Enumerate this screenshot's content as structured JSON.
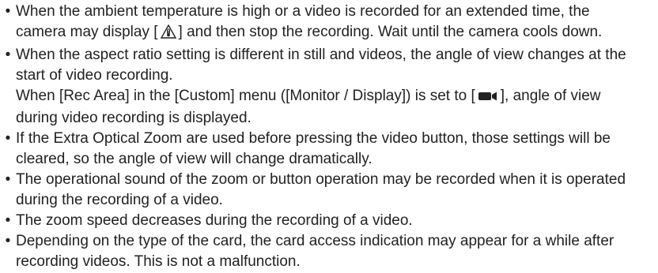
{
  "notes": [
    {
      "id": "temperature",
      "line1": "When the ambient temperature is high or a video is recorded for an extended time, the",
      "line2_before": "camera may display [",
      "line2_icon": "temperature-warning-icon",
      "line2_after": "] and then stop the recording. Wait until the camera cools down."
    },
    {
      "id": "aspect-ratio",
      "line1": "When the aspect ratio setting is different in still and videos, the angle of view changes at the",
      "line2": "start of video recording.",
      "line3_before": "When [Rec Area] in the [Custom] menu ([Monitor / Display]) is set to [",
      "line3_icon": "movie-camera-icon",
      "line3_after": "], angle of view",
      "line4": "during video recording is displayed."
    },
    {
      "id": "extra-zoom",
      "line1": "If the Extra Optical Zoom are used before pressing the video button, those settings will be",
      "line2": "cleared, so the angle of view will change dramatically."
    },
    {
      "id": "operational-sound",
      "line1": "The operational sound of the zoom or button operation may be recorded when it is operated",
      "line2": "during the recording of a video."
    },
    {
      "id": "zoom-speed",
      "line1": "The zoom speed decreases during the recording of a video."
    },
    {
      "id": "card-access",
      "line1": "Depending on the type of the card, the card access indication may appear for a while after",
      "line2": "recording videos. This is not a malfunction."
    }
  ],
  "bullet_char": "•"
}
